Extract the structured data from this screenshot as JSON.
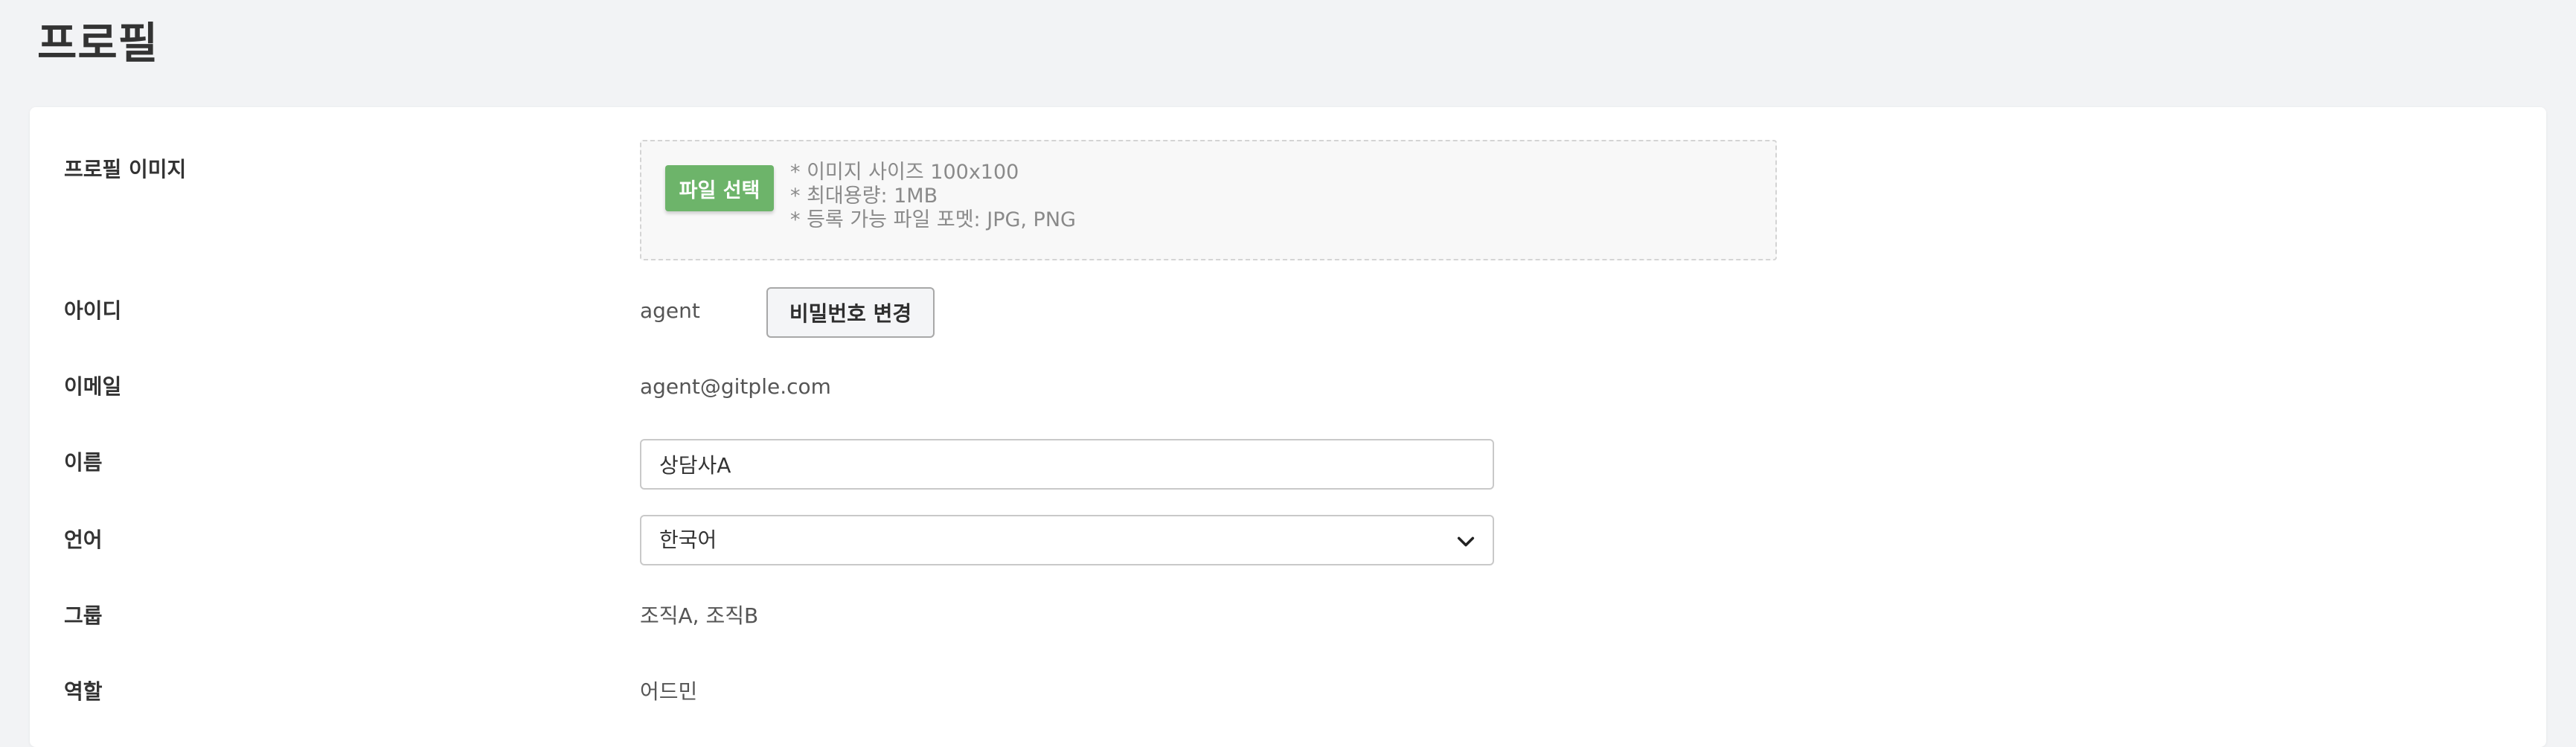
{
  "page": {
    "title": "프로필"
  },
  "profile_image": {
    "label": "프로필 이미지",
    "button_label": "파일 선택",
    "hints": [
      "* 이미지 사이즈 100x100",
      "* 최대용량: 1MB",
      "* 등록 가능 파일 포멧: JPG, PNG"
    ]
  },
  "id": {
    "label": "아이디",
    "value": "agent",
    "change_password_label": "비밀번호 변경"
  },
  "email": {
    "label": "이메일",
    "value": "agent@gitple.com"
  },
  "name": {
    "label": "이름",
    "value": "상담사A"
  },
  "language": {
    "label": "언어",
    "selected": "한국어"
  },
  "group": {
    "label": "그룹",
    "value": "조직A, 조직B"
  },
  "role": {
    "label": "역할",
    "value": "어드민"
  },
  "colors": {
    "page_background": "#f2f3f5",
    "card_background": "#ffffff",
    "file_button": "#6db46a",
    "hint_text": "#8a8a8a"
  },
  "icons": {
    "select_arrow": "chevron-down-icon"
  }
}
